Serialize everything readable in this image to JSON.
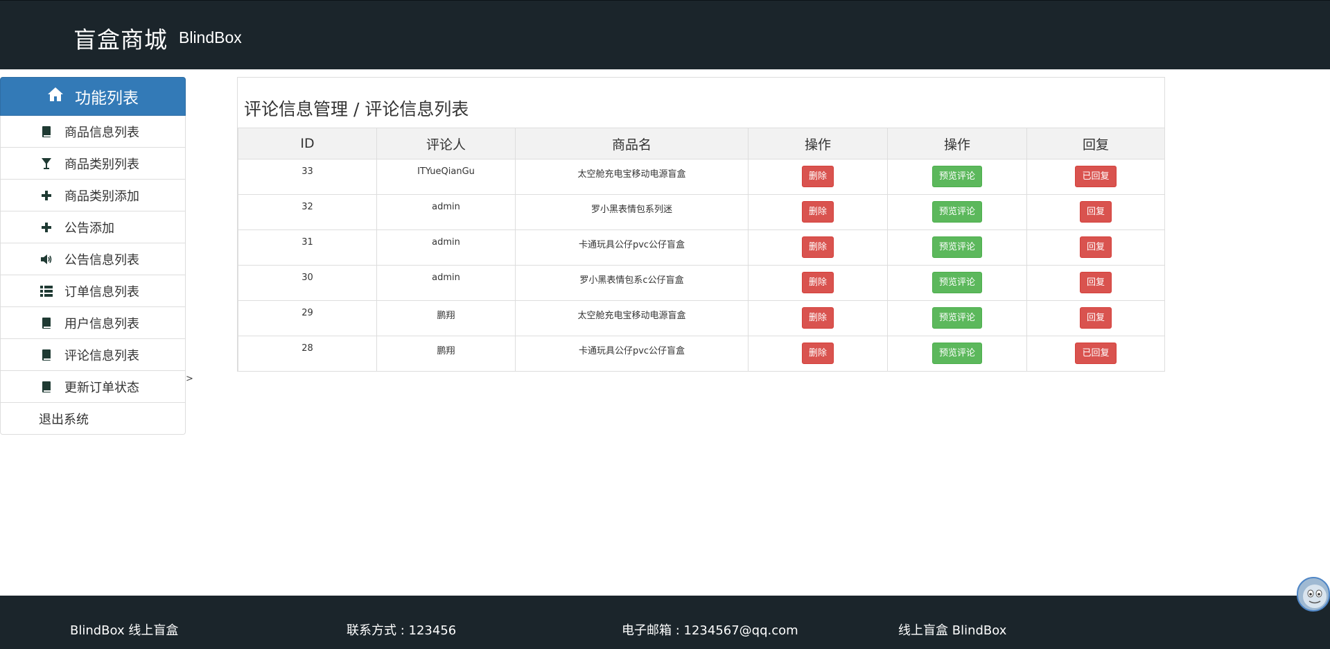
{
  "header": {
    "brand_cn": "盲盒商城",
    "brand_en": "BlindBox"
  },
  "sidebar": {
    "title": "功能列表",
    "title_icon": "home-icon",
    "items": [
      {
        "label": "商品信息列表",
        "icon": "book-icon"
      },
      {
        "label": "商品类别列表",
        "icon": "glass-icon"
      },
      {
        "label": "商品类别添加",
        "icon": "plus-icon"
      },
      {
        "label": "公告添加",
        "icon": "plus-icon"
      },
      {
        "label": "公告信息列表",
        "icon": "volume-icon"
      },
      {
        "label": "订单信息列表",
        "icon": "list-icon"
      },
      {
        "label": "用户信息列表",
        "icon": "book-icon"
      },
      {
        "label": "评论信息列表",
        "icon": "book-icon"
      },
      {
        "label": "更新订单状态",
        "icon": "book-icon"
      },
      {
        "label": "退出系统",
        "icon": ""
      }
    ],
    "collapse_arrow": ">"
  },
  "main": {
    "title": "评论信息管理 / 评论信息列表",
    "table": {
      "columns": [
        "ID",
        "评论人",
        "商品名",
        "操作",
        "操作",
        "回复"
      ],
      "rows": [
        {
          "id": "33",
          "commenter": "ITYueQianGu",
          "product": "太空舱充电宝移动电源盲盒",
          "delete": "删除",
          "preview": "预览评论",
          "reply": "已回复"
        },
        {
          "id": "32",
          "commenter": "admin",
          "product": "罗小黑表情包系列迷",
          "delete": "删除",
          "preview": "预览评论",
          "reply": "回复"
        },
        {
          "id": "31",
          "commenter": "admin",
          "product": "卡通玩具公仔pvc公仔盲盒",
          "delete": "删除",
          "preview": "预览评论",
          "reply": "回复"
        },
        {
          "id": "30",
          "commenter": "admin",
          "product": "罗小黑表情包系c公仔盲盒",
          "delete": "删除",
          "preview": "预览评论",
          "reply": "回复"
        },
        {
          "id": "29",
          "commenter": "鹏翔",
          "product": "太空舱充电宝移动电源盲盒",
          "delete": "删除",
          "preview": "预览评论",
          "reply": "回复"
        },
        {
          "id": "28",
          "commenter": "鹏翔",
          "product": "卡通玩具公仔pvc公仔盲盒",
          "delete": "删除",
          "preview": "预览评论",
          "reply": "已回复"
        }
      ]
    }
  },
  "footer": {
    "brand": "BlindBox 线上盲盒",
    "contact": "联系方式 : 123456",
    "email": "电子邮箱 : 1234567@qq.com",
    "slogan": "线上盲盒 BlindBox"
  },
  "colors": {
    "header_bg": "#1b252b",
    "sidebar_head_bg": "#337ab7",
    "danger": "#d9534f",
    "success": "#5cb85c"
  }
}
